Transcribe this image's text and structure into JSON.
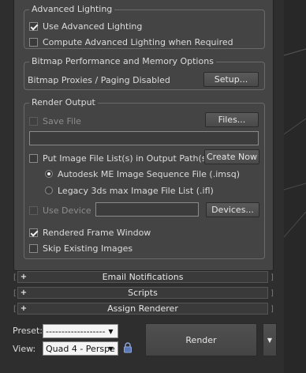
{
  "advanced_lighting": {
    "title": "Advanced Lighting",
    "use_label": "Use Advanced Lighting",
    "use_checked": true,
    "compute_label": "Compute Advanced Lighting when Required",
    "compute_checked": false
  },
  "bitmap": {
    "title": "Bitmap Performance and Memory Options",
    "status": "Bitmap Proxies / Paging Disabled",
    "setup_label": "Setup..."
  },
  "render_output": {
    "title": "Render Output",
    "save_file_label": "Save File",
    "files_label": "Files...",
    "put_image_label": "Put Image File List(s) in Output Path(s)",
    "create_now_label": "Create Now",
    "radio_imsq_label": "Autodesk ME Image Sequence File (.imsq)",
    "radio_ifl_label": "Legacy 3ds max Image File List (.ifl)",
    "use_device_label": "Use Device",
    "devices_label": "Devices...",
    "rendered_frame_label": "Rendered Frame Window",
    "rendered_frame_checked": true,
    "skip_existing_label": "Skip Existing Images"
  },
  "rollouts": [
    {
      "label": "Email Notifications"
    },
    {
      "label": "Scripts"
    },
    {
      "label": "Assign Renderer"
    }
  ],
  "bottom": {
    "preset_label": "Preset:",
    "preset_value": "-------------------",
    "view_label": "View:",
    "view_value": "Quad 4 - Perspe",
    "render_label": "Render"
  },
  "colors": {
    "panel": "#444444",
    "background": "#2e2e2e",
    "text": "#dcdcdc"
  }
}
